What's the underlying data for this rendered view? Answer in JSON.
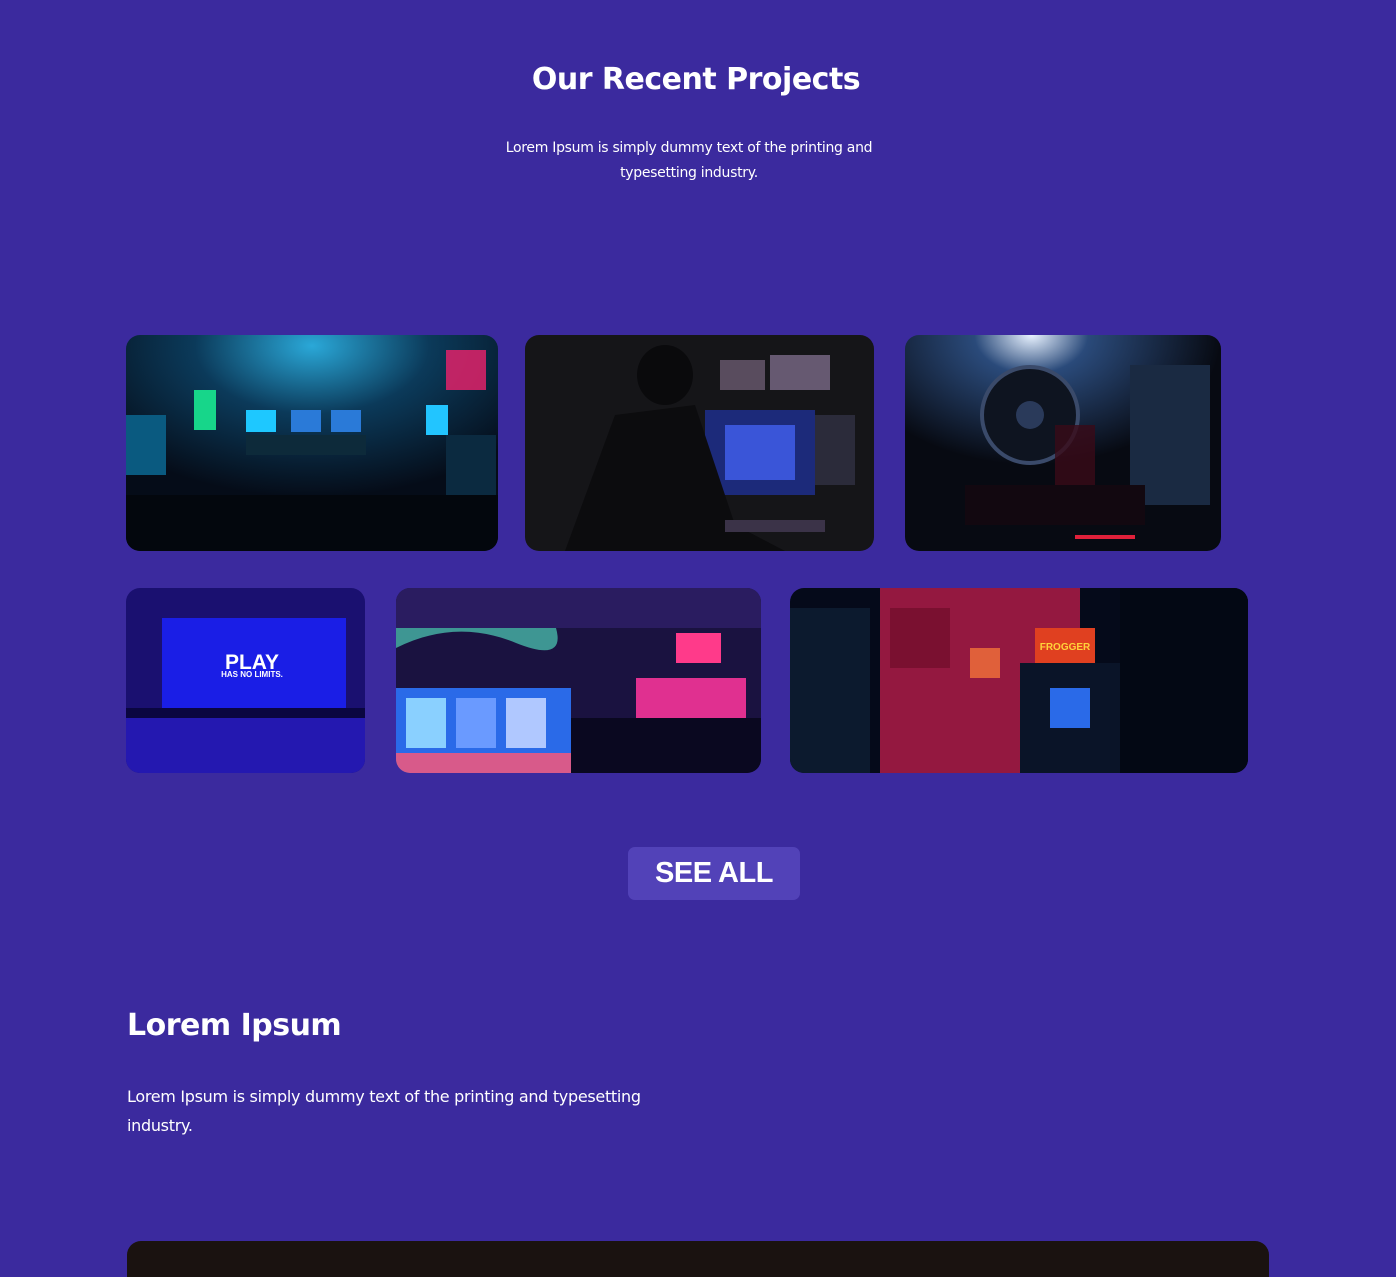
{
  "projects": {
    "title": "Our Recent Projects",
    "description": "Lorem Ipsum is simply dummy text of the printing and typesetting industry.",
    "images": [
      {
        "name": "arcade-room"
      },
      {
        "name": "gamer-at-monitor"
      },
      {
        "name": "pc-internals"
      },
      {
        "name": "play-screen",
        "screen_title": "PLAY",
        "screen_subtitle": "HAS NO LIMITS."
      },
      {
        "name": "neon-arcade-hall"
      },
      {
        "name": "red-arcade-cabinets",
        "sign_text": "FROGGER"
      }
    ],
    "see_all_label": "SEE ALL"
  },
  "section": {
    "title": "Lorem Ipsum",
    "description": "Lorem Ipsum is simply dummy text of the printing and typesetting industry."
  },
  "colors": {
    "background": "#3b2a9e",
    "button": "#5242b8",
    "dark_panel": "#1a1210",
    "text": "#ffffff"
  }
}
